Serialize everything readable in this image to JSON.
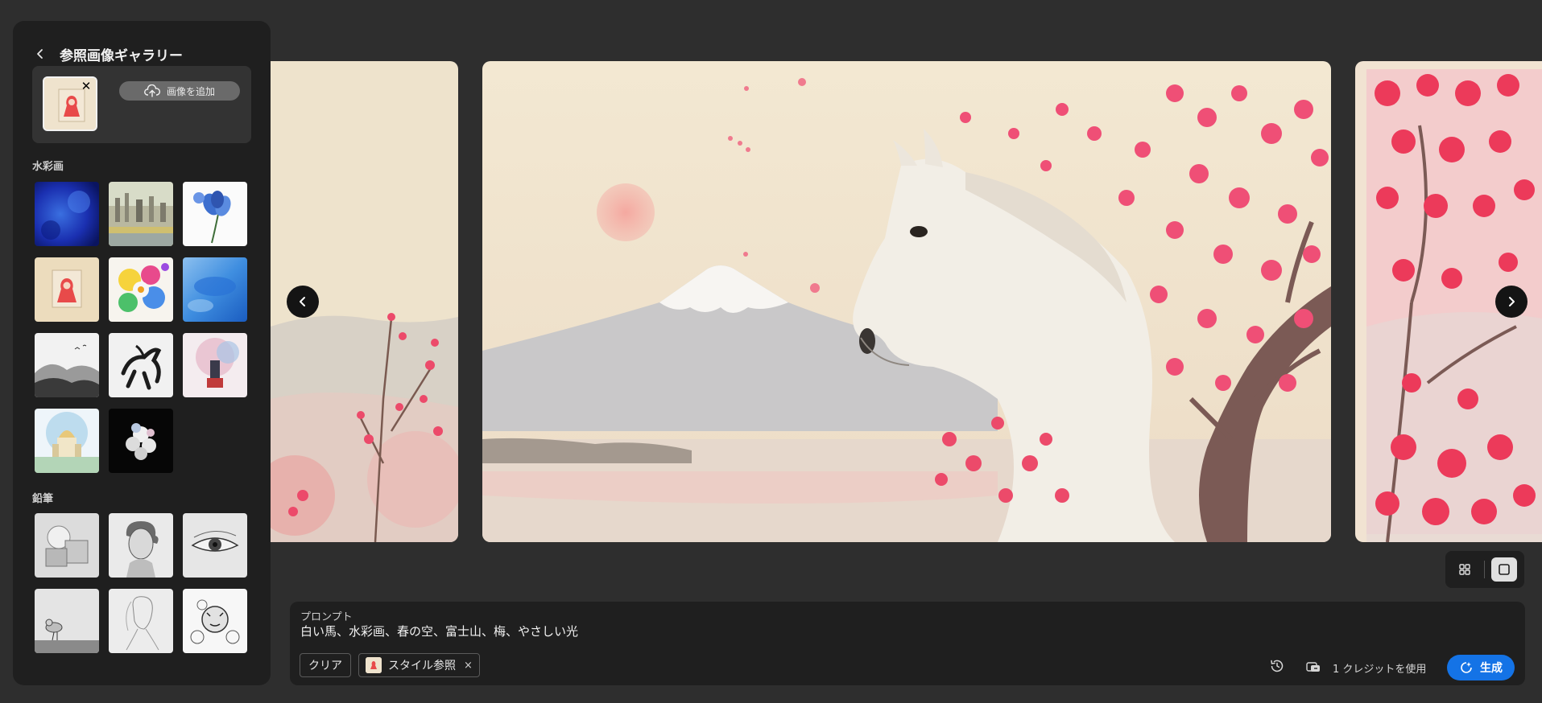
{
  "panel": {
    "title": "参照画像ギャラリー",
    "back_icon": "chevron-left-icon",
    "add_image_label": "画像を追加",
    "upload_icon": "cloud-upload-icon"
  },
  "sections": [
    {
      "label": "水彩画",
      "thumbnails": [
        "blue-ink-texture",
        "watercolor-city-skyline",
        "blue-flowers",
        "red-hood-figure",
        "colorful-flowers-splash",
        "blue-watercolor-wash",
        "ink-landscape",
        "ink-horse",
        "watercolor-locomotive",
        "watercolor-cathedral",
        "white-flowers-on-black"
      ]
    },
    {
      "label": "鉛筆",
      "thumbnails": [
        "pencil-geometric-shapes",
        "pencil-portrait-bust",
        "pencil-eye",
        "pencil-seagull",
        "pencil-woman-sketch",
        "pencil-tiger-flowers"
      ]
    }
  ],
  "prompt": {
    "label": "プロンプト",
    "text": "白い馬、水彩画、春の空、富士山、梅、やさしい光"
  },
  "chips": {
    "clear_label": "クリア",
    "style_ref_label": "スタイル参照",
    "remove_glyph": "×"
  },
  "footer": {
    "credit_text": "1 クレジットを使用",
    "generate_label": "生成"
  },
  "colors": {
    "accent": "#1473e6",
    "background": "#2e2e2e",
    "panel": "#1f1f1f"
  }
}
